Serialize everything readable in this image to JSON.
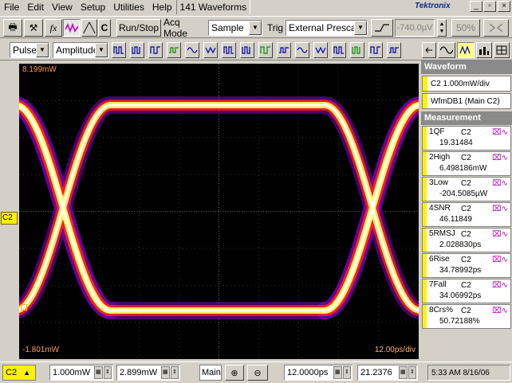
{
  "menu": {
    "items": [
      "File",
      "Edit",
      "View",
      "Setup",
      "Utilities",
      "Help"
    ],
    "waveforms": "141 Waveforms",
    "brand": "Tektronix"
  },
  "window": {
    "minimize": "_",
    "restore": "▫",
    "close": "×"
  },
  "toolbar": {
    "c_label": "C",
    "run_stop": "Run/Stop",
    "acq_mode_label": "Acq Mode",
    "acq_mode_value": "Sample",
    "trig_label": "Trig",
    "trig_value": "External Prescaler",
    "trig_level": "-740.0µV",
    "zoom_pct": "50%"
  },
  "toolbar2": {
    "pulse": "Pulse",
    "amplitude": "Amplitude"
  },
  "scope": {
    "top_value": "8.199mW",
    "bottom_value": "-1.801mW",
    "timebase": "12.00ps/div",
    "channel_marker": "C2"
  },
  "waveform_panel": {
    "title": "Waveform",
    "rows": [
      "C2 1.000mW/div",
      "WfmDB1 (Main C2)"
    ]
  },
  "measurement_panel": {
    "title": "Measurement",
    "items": [
      {
        "idx": "1",
        "name": "QF",
        "ch": "C2",
        "value": "19.31484"
      },
      {
        "idx": "2",
        "name": "High",
        "ch": "C2",
        "value": "6.498186mW"
      },
      {
        "idx": "3",
        "name": "Low",
        "ch": "C2",
        "value": "-204.5085µW"
      },
      {
        "idx": "4",
        "name": "SNR",
        "ch": "C2",
        "value": "46.11849"
      },
      {
        "idx": "5",
        "name": "RMSJ",
        "ch": "C2",
        "value": "2.028830ps"
      },
      {
        "idx": "6",
        "name": "Rise",
        "ch": "C2",
        "value": "34.78992ps"
      },
      {
        "idx": "7",
        "name": "Fall",
        "ch": "C2",
        "value": "34.06992ps"
      },
      {
        "idx": "8",
        "name": "Crs%",
        "ch": "C2",
        "value": "50.72188%"
      }
    ]
  },
  "statusbar": {
    "channel": "C2",
    "vert_scale": "1.000mW",
    "vert_offset": "2.899mW",
    "main": "Main",
    "horiz_scale": "12.0000ps",
    "horiz_pos": "21.2376",
    "time": "5:33 AM 8/16/06"
  },
  "colors": {
    "trace_core": "#ffffff",
    "trace_mid": "#ffff60",
    "trace_outer": "#ff2020",
    "trace_halo": "#8000c0",
    "grid": "#606060",
    "channel": "#fff200"
  }
}
